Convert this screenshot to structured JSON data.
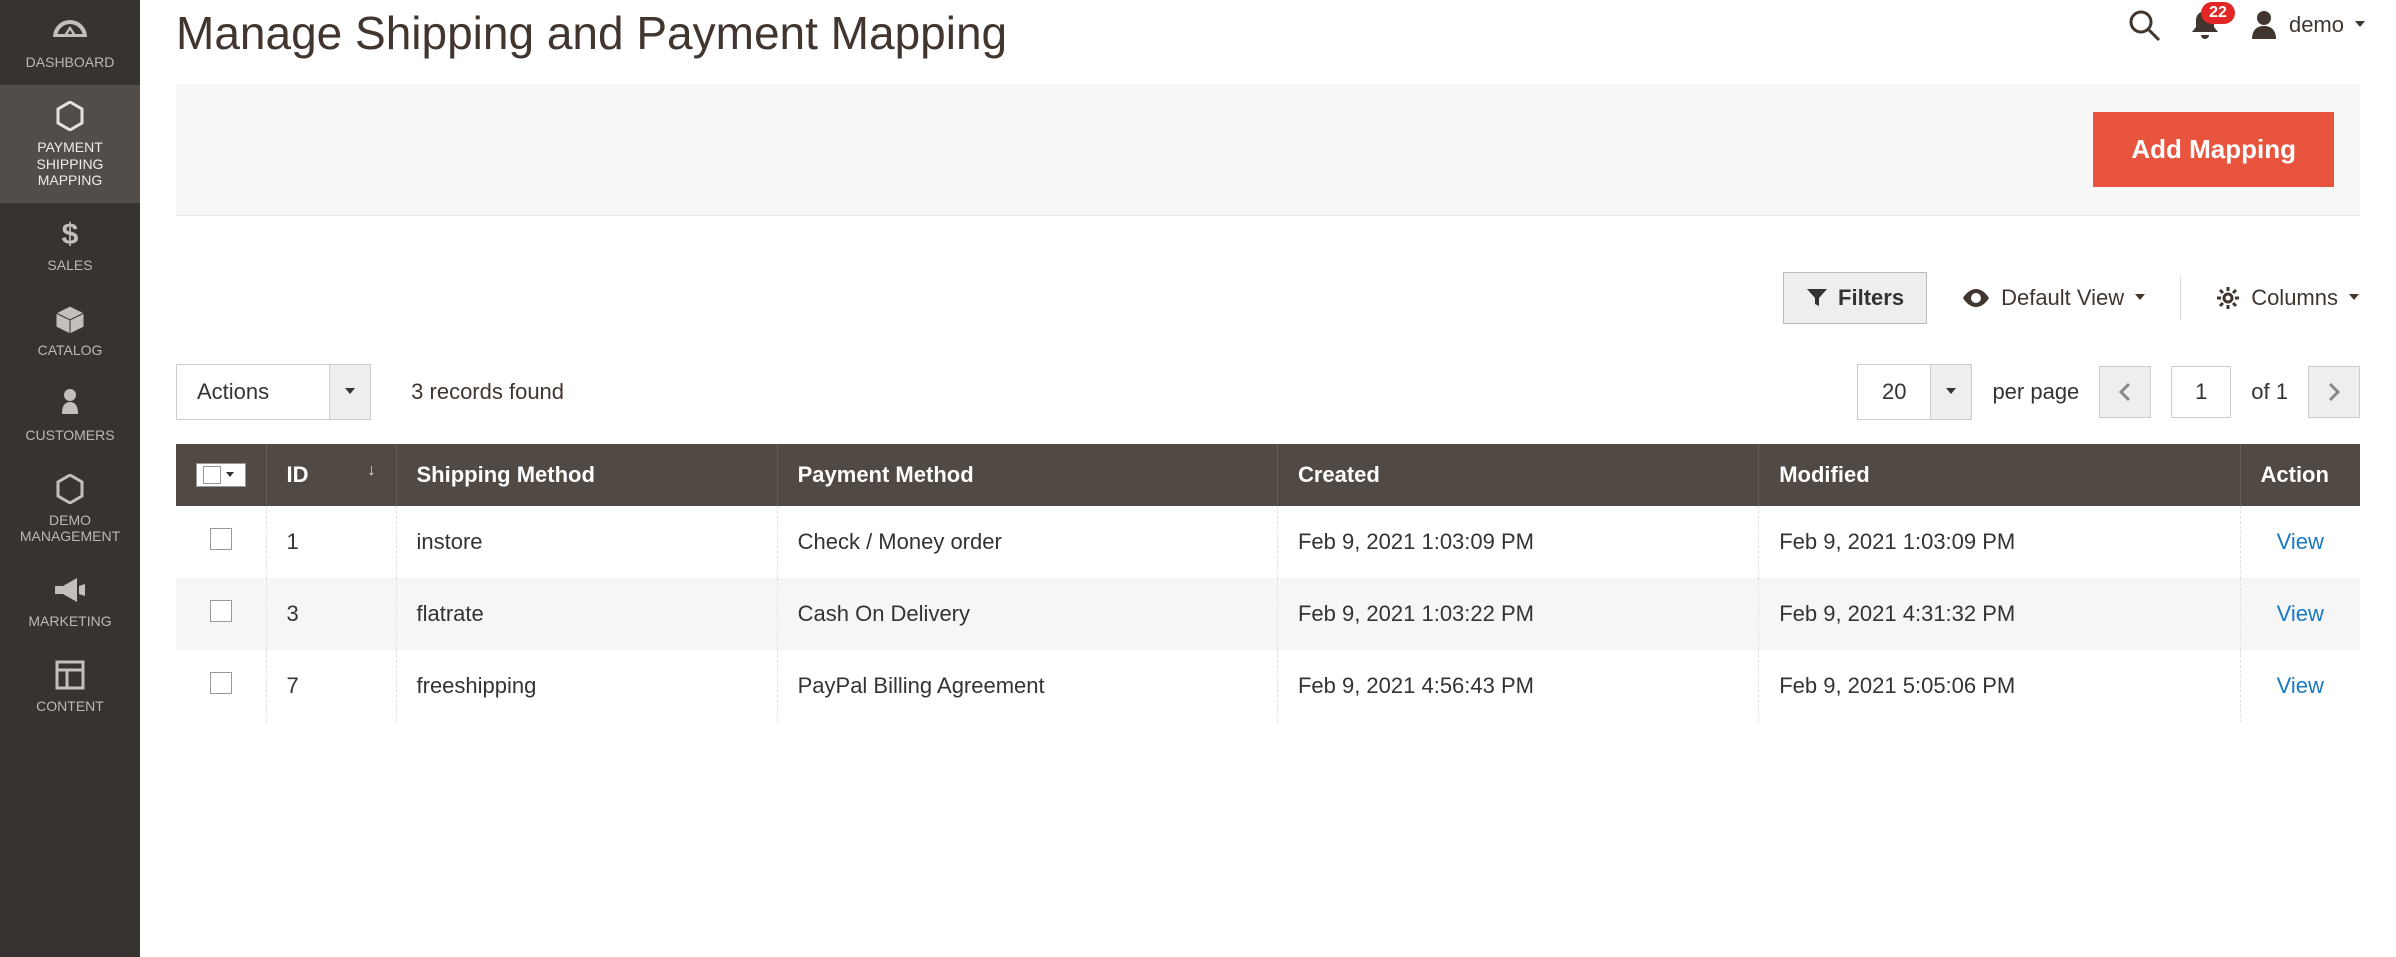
{
  "header": {
    "title": "Manage Shipping and Payment Mapping",
    "user_label": "demo",
    "notifications_count": "22"
  },
  "sidebar": {
    "items": [
      {
        "label": "DASHBOARD",
        "icon": "gauge-icon"
      },
      {
        "label": "PAYMENT SHIPPING MAPPING",
        "icon": "hexagon-icon",
        "active": true
      },
      {
        "label": "SALES",
        "icon": "dollar-icon"
      },
      {
        "label": "CATALOG",
        "icon": "box-icon"
      },
      {
        "label": "CUSTOMERS",
        "icon": "person-icon"
      },
      {
        "label": "DEMO MANAGEMENT",
        "icon": "hexagon-icon"
      },
      {
        "label": "MARKETING",
        "icon": "megaphone-icon"
      },
      {
        "label": "CONTENT",
        "icon": "layout-icon"
      }
    ]
  },
  "toolbar": {
    "add_button": "Add Mapping",
    "filters": "Filters",
    "default_view": "Default View",
    "columns": "Columns"
  },
  "grid_controls": {
    "actions_label": "Actions",
    "records_found": "3 records found",
    "per_page_value": "20",
    "per_page_label": "per page",
    "page_value": "1",
    "page_total": "of 1"
  },
  "table": {
    "columns": {
      "id": "ID",
      "shipping": "Shipping Method",
      "payment": "Payment Method",
      "created": "Created",
      "modified": "Modified",
      "action": "Action"
    },
    "rows": [
      {
        "id": "1",
        "shipping": "instore",
        "payment": "Check / Money order",
        "created": "Feb 9, 2021 1:03:09 PM",
        "modified": "Feb 9, 2021 1:03:09 PM",
        "action": "View"
      },
      {
        "id": "3",
        "shipping": "flatrate",
        "payment": "Cash On Delivery",
        "created": "Feb 9, 2021 1:03:22 PM",
        "modified": "Feb 9, 2021 4:31:32 PM",
        "action": "View"
      },
      {
        "id": "7",
        "shipping": "freeshipping",
        "payment": "PayPal Billing Agreement",
        "created": "Feb 9, 2021 4:56:43 PM",
        "modified": "Feb 9, 2021 5:05:06 PM",
        "action": "View"
      }
    ]
  }
}
